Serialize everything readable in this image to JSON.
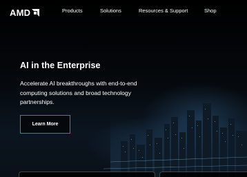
{
  "brand": {
    "name": "AMD"
  },
  "nav": {
    "items": [
      "Products",
      "Solutions",
      "Resources & Support",
      "Shop"
    ]
  },
  "hero": {
    "title": "AI in the Enterprise",
    "description": "Accelerate AI breakthroughs with end-to-end computing solutions and broad technology partnerships.",
    "cta_label": "Learn More"
  },
  "colors": {
    "background": "#000000",
    "cta_border": "#0c9aa3",
    "text": "#ffffff"
  },
  "icons": {
    "logo_mark": "amd-arrow-logo-icon"
  }
}
